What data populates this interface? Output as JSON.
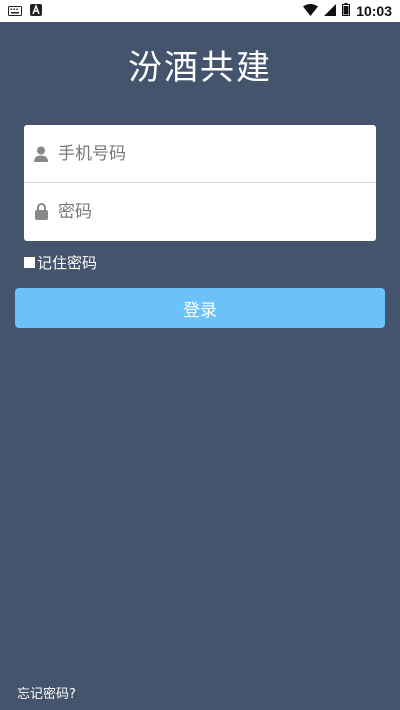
{
  "status_bar": {
    "time": "10:03",
    "left_icons": [
      "keyboard-icon",
      "a-app-icon"
    ],
    "right_icons": [
      "wifi-icon",
      "signal-icon",
      "battery-icon"
    ]
  },
  "app": {
    "title": "汾酒共建"
  },
  "login_form": {
    "phone_placeholder": "手机号码",
    "password_placeholder": "密码",
    "remember_label": "记住密码",
    "login_button": "登录",
    "forgot_link": "忘记密码?"
  },
  "colors": {
    "background": "#45546d",
    "button": "#6bc2f8",
    "card": "#ffffff"
  }
}
